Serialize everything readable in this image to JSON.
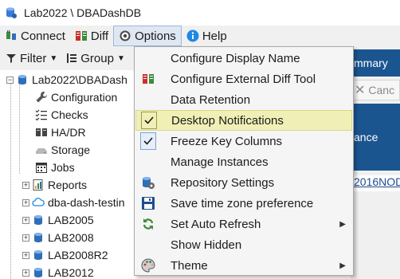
{
  "window": {
    "title": "Lab2022 \\ DBADashDB",
    "app_icon": "database-icon"
  },
  "menubar": {
    "items": [
      {
        "label": "Connect",
        "icon": "plug-icon"
      },
      {
        "label": "Diff",
        "icon": "diff-icon"
      },
      {
        "label": "Options",
        "icon": "gear-icon",
        "active": true
      },
      {
        "label": "Help",
        "icon": "info-icon"
      }
    ]
  },
  "toolbar": {
    "filter_label": "Filter",
    "group_label": "Group"
  },
  "tree": {
    "root_label": "Lab2022\\DBADash",
    "items": [
      {
        "label": "Configuration",
        "icon": "wrench-icon"
      },
      {
        "label": "Checks",
        "icon": "checklist-icon"
      },
      {
        "label": "HA/DR",
        "icon": "server-pair-icon"
      },
      {
        "label": "Storage",
        "icon": "disk-icon"
      },
      {
        "label": "Jobs",
        "icon": "calendar-icon"
      },
      {
        "label": "Reports",
        "icon": "report-icon"
      },
      {
        "label": "dba-dash-testin",
        "icon": "cloud-icon"
      },
      {
        "label": "LAB2005",
        "icon": "database-icon"
      },
      {
        "label": "LAB2008",
        "icon": "database-icon"
      },
      {
        "label": "LAB2008R2",
        "icon": "database-icon"
      },
      {
        "label": "LAB2012",
        "icon": "database-icon"
      }
    ]
  },
  "background_panel": {
    "summary_label": "mmary",
    "cancel_label": "Canc",
    "instance_label": "ance",
    "link_label": "2016NOD"
  },
  "options_menu": {
    "items": [
      {
        "label": "Configure Display Name",
        "icon": ""
      },
      {
        "label": "Configure External Diff Tool",
        "icon": "diff-icon"
      },
      {
        "label": "Data Retention",
        "icon": ""
      },
      {
        "label": "Desktop Notifications",
        "icon": "check-icon",
        "checked": true,
        "highlighted": true
      },
      {
        "label": "Freeze Key Columns",
        "icon": "check-icon",
        "checked": true
      },
      {
        "label": "Manage Instances",
        "icon": ""
      },
      {
        "label": "Repository Settings",
        "icon": "database-gear-icon"
      },
      {
        "label": "Save time zone preference",
        "icon": "save-icon"
      },
      {
        "label": "Set Auto Refresh",
        "icon": "refresh-icon",
        "submenu": true
      },
      {
        "label": "Show Hidden",
        "icon": ""
      },
      {
        "label": "Theme",
        "icon": "palette-icon",
        "submenu": true
      }
    ]
  }
}
